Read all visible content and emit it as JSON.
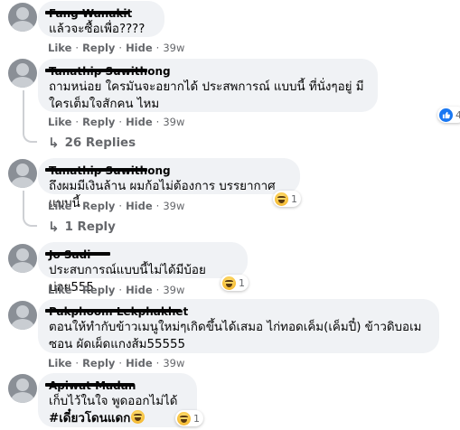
{
  "actions": {
    "like": "Like",
    "reply": "Reply",
    "hide": "Hide",
    "separator": "·"
  },
  "comments": [
    {
      "author": "Fang Wanakit",
      "text": "แล้วจะซื้อเพื่อ????",
      "time": "39w"
    },
    {
      "author": "Tanathip Suwithong",
      "text": "ถามหน่อย ใครมันจะอยากได้ ประสพการณ์ แบบนี้ ที่นั่งๆอยู่ มีใครเต็มใจสักคน ไหม",
      "time": "39w",
      "reaction_count": "4",
      "replies": "26 Replies"
    },
    {
      "author": "Tanathip Suwithong",
      "text": "ถึงผมมีเงินล้าน ผมก้อไม่ต้องการ บรรยากาศแบบนี้",
      "time": "39w",
      "reaction_count": "1",
      "replies": "1 Reply"
    },
    {
      "author": "Jo Sadi",
      "text": "ประสบการณ์แบบนี้ไม่ได้มีบ้อยบ่อย555",
      "time": "39w",
      "reaction_count": "1"
    },
    {
      "author": "Pakphoom Lekphakhet",
      "text": "ตอนให้ทำกับข้าวเมนูใหม่ๆเกิดขึ้นได้เสมอ ไก่ทอดเค็ม(เค็มปี๋) ข้าวดิบอเมซอน ผัดเผ็ดแกงส้ม55555",
      "time": "39w"
    },
    {
      "author": "Apiwat Madan",
      "text": "เก็บไว้ในใจ พูดออกไม่ได้",
      "text2": "#เดี๋ยวโดนแดก",
      "time": "39w",
      "reaction_count": "1"
    }
  ],
  "colors": {
    "bubble": "#f0f2f5",
    "meta": "#65676b",
    "like_blue": "#1877f2",
    "haha_yellow": "#f7c23d"
  },
  "icons": {
    "reply_arrow": "↳",
    "like_reaction": "like-icon",
    "haha_reaction": "haha-icon"
  }
}
